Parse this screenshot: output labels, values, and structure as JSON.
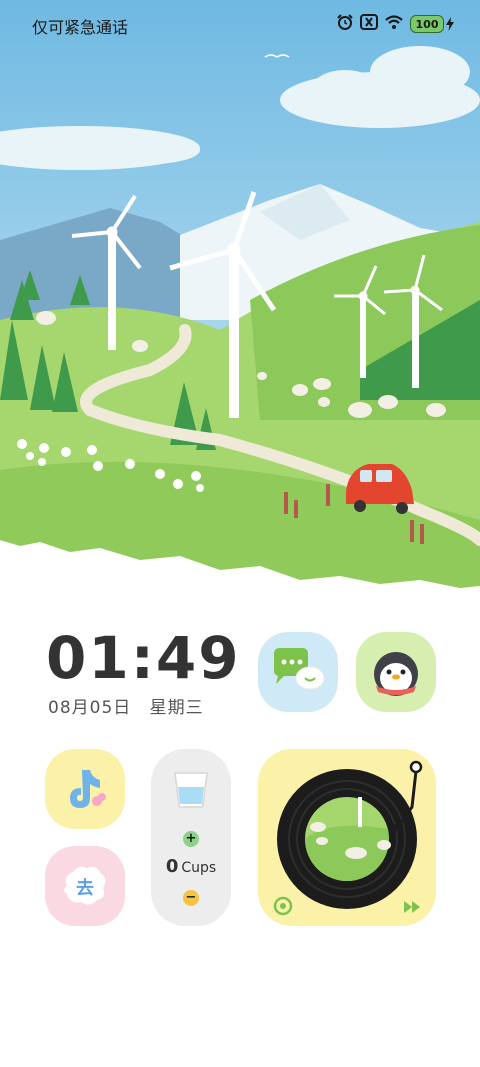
{
  "status_bar": {
    "carrier_text": "仅可紧急通话",
    "battery": "100",
    "icons": [
      "alarm-icon",
      "nfc-icon",
      "wifi-icon",
      "battery-icon",
      "charging-bolt-icon"
    ]
  },
  "wallpaper": {
    "scene": "windmill-meadow-illustration"
  },
  "clock": {
    "time": "01:49",
    "date": "08月05日",
    "weekday": "星期三"
  },
  "apps": [
    {
      "name": "chat-app",
      "icon": "chat-bubbles-icon",
      "color": "#cfeaf6"
    },
    {
      "name": "penguin-app",
      "icon": "penguin-icon",
      "color": "#d6efb0"
    },
    {
      "name": "tiktok-app",
      "icon": "tiktok-note-icon",
      "color": "#fbf1a8"
    },
    {
      "name": "hat-app",
      "icon": "hat-icon",
      "color": "#fbd9e3"
    }
  ],
  "water_widget": {
    "count": "0",
    "unit": "Cups",
    "plus_label": "+",
    "minus_label": "−"
  },
  "music_widget": {
    "icons": [
      "vinyl-record-icon",
      "tonearm-icon",
      "netease-music-icon",
      "fast-forward-icon"
    ],
    "bg_color": "#fbf1a8"
  },
  "colors": {
    "sky": "#8fcbe8",
    "grass": "#9fd36a",
    "text_dark": "#333333"
  }
}
